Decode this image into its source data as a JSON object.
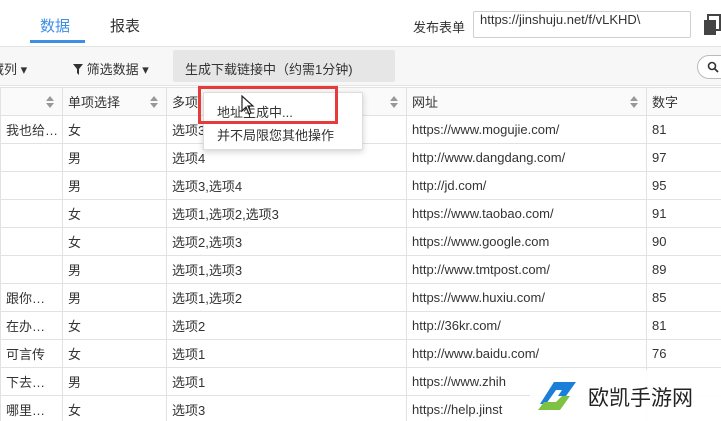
{
  "tabs": [
    {
      "label": "数据",
      "active": true
    },
    {
      "label": "报表",
      "active": false
    }
  ],
  "publish": {
    "label": "发布表单",
    "url": "https://jinshuju.net/f/vLKHD\\"
  },
  "toolbar": {
    "hidden_columns": "隐藏列",
    "filter": "筛选数据",
    "progress": "生成下载链接中（约需1分钟)"
  },
  "table": {
    "headers": [
      "",
      "单项选择",
      "多项",
      "网址",
      "数字"
    ],
    "rows": [
      [
        "我也给…",
        "女",
        "选项3",
        "https://www.mogujie.com/",
        "81"
      ],
      [
        "",
        "男",
        "选项4",
        "http://www.dangdang.com/",
        "97"
      ],
      [
        "",
        "男",
        "选项3,选项4",
        "http://jd.com/",
        "95"
      ],
      [
        "",
        "女",
        "选项1,选项2,选项3",
        "https://www.taobao.com/",
        "91"
      ],
      [
        "",
        "女",
        "选项2,选项3",
        "https://www.google.com",
        "90"
      ],
      [
        "",
        "男",
        "选项1,选项3",
        "http://www.tmtpost.com/",
        "89"
      ],
      [
        "跟你…",
        "男",
        "选项1,选项2",
        "https://www.huxiu.com/",
        "85"
      ],
      [
        "在办…",
        "女",
        "选项2",
        "http://36kr.com/",
        "81"
      ],
      [
        "可言传",
        "女",
        "选项1",
        "http://www.baidu.com/",
        "76"
      ],
      [
        "下去…",
        "男",
        "选项1",
        "https://www.zhih",
        ""
      ],
      [
        "哪里…",
        "女",
        "选项3",
        "https://help.jinst",
        ""
      ]
    ]
  },
  "dropdown": {
    "items": [
      "地址生成中...",
      "并不局限您其他操作"
    ]
  },
  "watermark": {
    "text": "欧凯手游网"
  },
  "colors": {
    "accent": "#3d8ee6",
    "highlight": "#e53b3b",
    "logo_blue": "#1a7fd8",
    "logo_green": "#7dc243"
  }
}
